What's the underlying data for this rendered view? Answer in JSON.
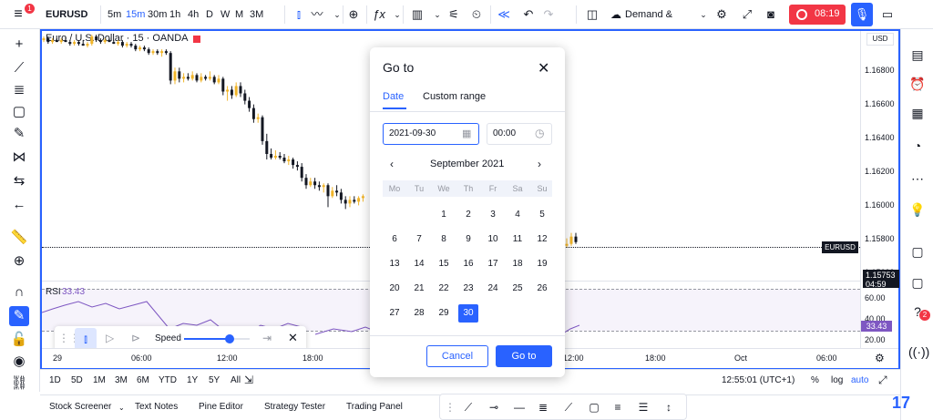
{
  "header": {
    "symbol": "EURUSD",
    "intervals": [
      "5m",
      "15m",
      "30m",
      "1h",
      "4h",
      "D",
      "W",
      "M",
      "3M"
    ],
    "active_interval": "15m",
    "layout_name": "Demand & Su...",
    "record_time": "08:19",
    "notif_count": "1"
  },
  "chart": {
    "title": "Euro / U.S. Dollar · 15 · OANDA",
    "currency": "USD",
    "price_labels": [
      "1.16800",
      "1.16600",
      "1.16400",
      "1.16200",
      "1.16000",
      "1.15800",
      "1.15600"
    ],
    "symbol_tag": "EURUSD",
    "last_price": "1.15753",
    "countdown": "04:59",
    "rsi_label": "RSI",
    "rsi_value": "33.43",
    "rsi_levels": [
      "60.00",
      "40.00",
      "20.00"
    ],
    "rsi_tag": "33.43",
    "time_labels": [
      "29",
      "06:00",
      "12:00",
      "18:00",
      "12:00",
      "18:00",
      "Oct",
      "06:00"
    ]
  },
  "candles": [
    [
      0,
      1.1685,
      1.1687,
      1.1684,
      1.1686
    ],
    [
      1,
      1.1686,
      1.1687,
      1.1683,
      1.1684
    ],
    [
      2,
      1.1684,
      1.1686,
      1.1683,
      1.1685
    ],
    [
      3,
      1.1685,
      1.1686,
      1.1684,
      1.1684
    ],
    [
      4,
      1.1684,
      1.1686,
      1.1683,
      1.1685
    ],
    [
      5,
      1.1685,
      1.1687,
      1.1684,
      1.1684
    ],
    [
      6,
      1.1684,
      1.1685,
      1.1682,
      1.1683
    ],
    [
      7,
      1.1683,
      1.1685,
      1.1682,
      1.1684
    ],
    [
      8,
      1.1684,
      1.1685,
      1.1682,
      1.1683
    ],
    [
      9,
      1.1683,
      1.1685,
      1.1682,
      1.1682
    ],
    [
      10,
      1.1682,
      1.1684,
      1.1681,
      1.1683
    ],
    [
      11,
      1.1683,
      1.1688,
      1.1682,
      1.1687
    ],
    [
      12,
      1.1687,
      1.1688,
      1.1684,
      1.1685
    ],
    [
      13,
      1.1685,
      1.1686,
      1.1683,
      1.1684
    ],
    [
      14,
      1.1684,
      1.1686,
      1.1683,
      1.1685
    ],
    [
      15,
      1.1685,
      1.1686,
      1.1684,
      1.1684
    ],
    [
      16,
      1.1684,
      1.1685,
      1.1683,
      1.1683
    ],
    [
      17,
      1.1683,
      1.1685,
      1.1682,
      1.1684
    ],
    [
      18,
      1.1684,
      1.1685,
      1.1681,
      1.1682
    ],
    [
      19,
      1.1682,
      1.1684,
      1.1681,
      1.1683
    ],
    [
      20,
      1.1683,
      1.1684,
      1.1681,
      1.1682
    ],
    [
      21,
      1.1682,
      1.1683,
      1.1679,
      1.168
    ],
    [
      22,
      1.168,
      1.1682,
      1.1679,
      1.1681
    ],
    [
      23,
      1.1681,
      1.1682,
      1.1679,
      1.168
    ],
    [
      24,
      1.168,
      1.1681,
      1.1677,
      1.1678
    ],
    [
      25,
      1.1678,
      1.168,
      1.1677,
      1.1679
    ],
    [
      26,
      1.1679,
      1.168,
      1.1677,
      1.1678
    ],
    [
      27,
      1.1678,
      1.168,
      1.1676,
      1.1679
    ],
    [
      28,
      1.1679,
      1.168,
      1.1677,
      1.1678
    ],
    [
      29,
      1.1678,
      1.1679,
      1.1661,
      1.1663
    ],
    [
      30,
      1.1663,
      1.167,
      1.1661,
      1.1668
    ],
    [
      31,
      1.1668,
      1.167,
      1.1662,
      1.1664
    ],
    [
      32,
      1.1664,
      1.1667,
      1.1662,
      1.1665
    ],
    [
      33,
      1.1665,
      1.1667,
      1.1663,
      1.1664
    ],
    [
      34,
      1.1664,
      1.1668,
      1.1663,
      1.1666
    ],
    [
      35,
      1.1666,
      1.1667,
      1.1662,
      1.1663
    ],
    [
      36,
      1.1663,
      1.1667,
      1.1662,
      1.1665
    ],
    [
      37,
      1.1665,
      1.1666,
      1.1663,
      1.1664
    ],
    [
      38,
      1.1664,
      1.1668,
      1.1663,
      1.1665
    ],
    [
      39,
      1.1665,
      1.1666,
      1.1661,
      1.1662
    ],
    [
      40,
      1.1662,
      1.1666,
      1.1661,
      1.1664
    ],
    [
      41,
      1.1664,
      1.1665,
      1.1655,
      1.1657
    ],
    [
      42,
      1.1657,
      1.166,
      1.1652,
      1.1658
    ],
    [
      43,
      1.1658,
      1.166,
      1.1653,
      1.1655
    ],
    [
      44,
      1.1655,
      1.1662,
      1.1654,
      1.166
    ],
    [
      45,
      1.166,
      1.1662,
      1.1654,
      1.1656
    ],
    [
      46,
      1.1656,
      1.1658,
      1.165,
      1.1652
    ],
    [
      47,
      1.1652,
      1.1654,
      1.1646,
      1.1648
    ],
    [
      48,
      1.1648,
      1.165,
      1.164,
      1.1642
    ],
    [
      49,
      1.1642,
      1.1645,
      1.164,
      1.1643
    ],
    [
      50,
      1.1643,
      1.1644,
      1.1628,
      1.163
    ],
    [
      51,
      1.163,
      1.1634,
      1.162,
      1.1623
    ],
    [
      52,
      1.1623,
      1.1626,
      1.162,
      1.1621
    ],
    [
      53,
      1.1621,
      1.1625,
      1.162,
      1.1622
    ],
    [
      54,
      1.1622,
      1.1624,
      1.162,
      1.1621
    ],
    [
      55,
      1.1621,
      1.1623,
      1.1618,
      1.1619
    ],
    [
      56,
      1.1619,
      1.1622,
      1.1617,
      1.162
    ],
    [
      57,
      1.162,
      1.1621,
      1.1615,
      1.1617
    ],
    [
      58,
      1.1617,
      1.1619,
      1.1614,
      1.1616
    ],
    [
      59,
      1.1616,
      1.1618,
      1.1608,
      1.161
    ],
    [
      60,
      1.161,
      1.1612,
      1.1604,
      1.1606
    ],
    [
      61,
      1.1606,
      1.161,
      1.1605,
      1.1608
    ],
    [
      62,
      1.1608,
      1.161,
      1.1604,
      1.1606
    ],
    [
      63,
      1.1606,
      1.1608,
      1.1603,
      1.1605
    ],
    [
      64,
      1.1605,
      1.1607,
      1.1602,
      1.1606
    ],
    [
      65,
      1.1606,
      1.1607,
      1.1594,
      1.16
    ],
    [
      66,
      1.16,
      1.1605,
      1.1599,
      1.1603
    ],
    [
      67,
      1.1603,
      1.1606,
      1.16,
      1.1602
    ],
    [
      68,
      1.1602,
      1.1604,
      1.1596,
      1.1598
    ],
    [
      69,
      1.1598,
      1.16,
      1.1593,
      1.1596
    ],
    [
      70,
      1.1596,
      1.16,
      1.1594,
      1.1598
    ],
    [
      71,
      1.1598,
      1.16,
      1.1596,
      1.1597
    ],
    [
      72,
      1.1597,
      1.16,
      1.1595,
      1.1599
    ],
    [
      73,
      1.1599,
      1.1601,
      1.1597,
      1.16
    ]
  ],
  "last_candles": [
    [
      0,
      1.1573,
      1.1577,
      1.1572,
      1.1574
    ],
    [
      1,
      1.1574,
      1.158,
      1.1573,
      1.1578
    ],
    [
      2,
      1.1578,
      1.158,
      1.1574,
      1.1575
    ]
  ],
  "replay": {
    "speed_label": "Speed",
    "speed": 0.7
  },
  "dialog": {
    "title": "Go to",
    "tab_date": "Date",
    "tab_custom": "Custom range",
    "date_value": "2021-09-30",
    "time_value": "00:00",
    "month": "September 2021",
    "weekdays": [
      "Mo",
      "Tu",
      "We",
      "Th",
      "Fr",
      "Sa",
      "Su"
    ],
    "weeks": [
      [
        "",
        "",
        "1",
        "2",
        "3",
        "4",
        "5"
      ],
      [
        "6",
        "7",
        "8",
        "9",
        "10",
        "11",
        "12"
      ],
      [
        "13",
        "14",
        "15",
        "16",
        "17",
        "18",
        "19"
      ],
      [
        "20",
        "21",
        "22",
        "23",
        "24",
        "25",
        "26"
      ],
      [
        "27",
        "28",
        "29",
        "30",
        "",
        "",
        ""
      ]
    ],
    "selected_day": "30",
    "cancel": "Cancel",
    "goto": "Go to"
  },
  "footer": {
    "ranges": [
      "1D",
      "5D",
      "1M",
      "3M",
      "6M",
      "YTD",
      "1Y",
      "5Y",
      "All"
    ],
    "clock": "12:55:01 (UTC+1)",
    "percent": "%",
    "log": "log",
    "auto": "auto"
  },
  "bottom_tabs": [
    "Stock Screener",
    "Text Notes",
    "Pine Editor",
    "Strategy Tester",
    "Trading Panel"
  ],
  "right_badge": "2",
  "colors": {
    "accent": "#2962ff",
    "record": "#f23645",
    "rsi": "#7e57c2",
    "candle_up": "#f0b429",
    "candle_down": "#131722"
  }
}
